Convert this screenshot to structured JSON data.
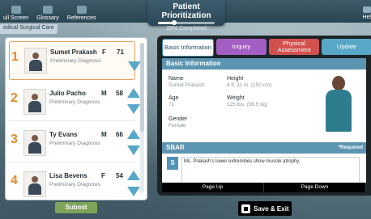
{
  "topnav": {
    "full_screen": "ull Screen",
    "glossary": "Glossary",
    "references": "References",
    "help": "Hel"
  },
  "title": {
    "text": "Patient Prioritization",
    "progress_label": "28% Completed",
    "progress_fraction": 0.28
  },
  "crumb": "edical Surgical Care",
  "patients": [
    {
      "num": "1",
      "name": "Sumet Prakash",
      "sex": "F",
      "age": "71",
      "diagnosis": "Preliminary Diagnosis"
    },
    {
      "num": "2",
      "name": "Julio Pacho",
      "sex": "M",
      "age": "58",
      "diagnosis": "Preliminary Diagnosis"
    },
    {
      "num": "3",
      "name": "Ty Evans",
      "sex": "M",
      "age": "66",
      "diagnosis": "Preliminary Diagnosis"
    },
    {
      "num": "4",
      "name": "Lisa Bevens",
      "sex": "F",
      "age": "54",
      "diagnosis": "Preliminary Diagnosis"
    }
  ],
  "tabs": {
    "basic": "Basic Information",
    "inquiry": "Inquiry",
    "physical": "Physical Assessment",
    "update": "Update"
  },
  "basic_info": {
    "header": "Basic Information",
    "name_label": "Name",
    "name_value": "Sumet Prakash",
    "age_label": "Age",
    "age_value": "71",
    "gender_label": "Gender",
    "gender_value": "Female",
    "height_label": "Height",
    "height_value": "4 ft. 11 in. (150 cm)",
    "weight_label": "Weight",
    "weight_value": "125 lbs. (56.5 kg)"
  },
  "sbar": {
    "header": "SBAR",
    "required": "*Required",
    "letter": "S",
    "text": "Ms. Prakash's lower extremities show muscle atrophy."
  },
  "paging": {
    "up": "Page Up",
    "down": "Page Down"
  },
  "buttons": {
    "submit": "Submit",
    "save_exit": "Save & Exit"
  }
}
